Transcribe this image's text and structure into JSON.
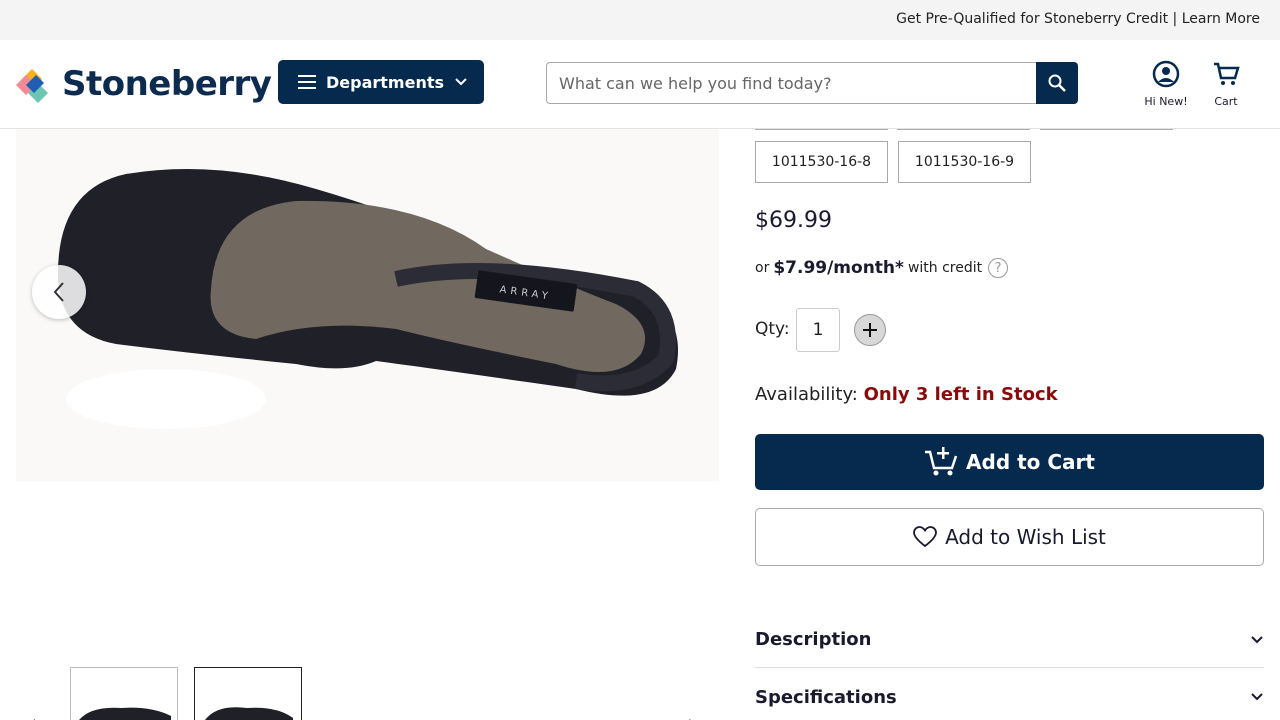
{
  "promo": {
    "text": "Get Pre-Qualified for Stoneberry Credit | Learn More"
  },
  "header": {
    "logo_text": "Stoneberry",
    "departments_label": "Departments",
    "search_placeholder": "What can we help you find today?",
    "account_label": "Hi New!",
    "cart_label": "Cart"
  },
  "product": {
    "sku_options": [
      "1011530-16-8",
      "1011530-16-9"
    ],
    "price": "$69.99",
    "credit": {
      "prefix": "or",
      "amount": "$7.99/month*",
      "suffix": "with credit"
    },
    "qty": {
      "label": "Qty:",
      "value": "1"
    },
    "availability": {
      "label": "Availability:",
      "status": "Only 3 left in Stock"
    },
    "add_to_cart_label": "Add to Cart",
    "wishlist_label": "Add to Wish List",
    "brand_tag": "ARRAY"
  },
  "accordions": {
    "description": "Description",
    "specifications": "Specifications"
  },
  "colors": {
    "navy": "#052a4e",
    "stock_red": "#8a0a0a"
  }
}
